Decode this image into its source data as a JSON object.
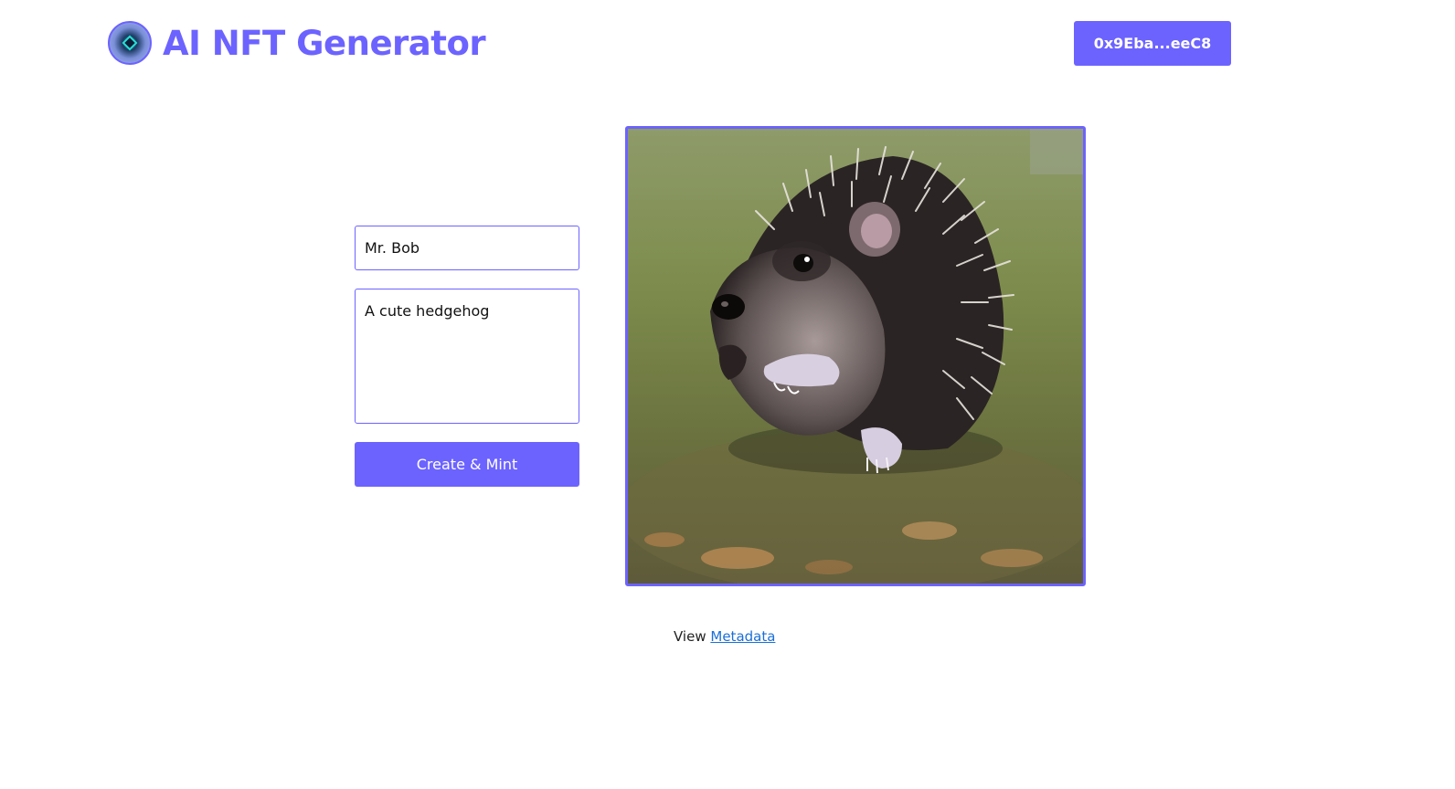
{
  "header": {
    "title": "AI NFT Generator",
    "logo_icon": "nft-gem-logo-icon",
    "wallet_address": "0x9Eba...eeC8"
  },
  "form": {
    "name_value": "Mr. Bob",
    "description_value": "A cute hedgehog",
    "submit_label": "Create & Mint"
  },
  "image": {
    "alt": "A cute hedgehog"
  },
  "metadata": {
    "prefix": "View",
    "link_label": "Metadata"
  },
  "colors": {
    "accent": "#6c63ff",
    "link": "#1a6fd8"
  }
}
